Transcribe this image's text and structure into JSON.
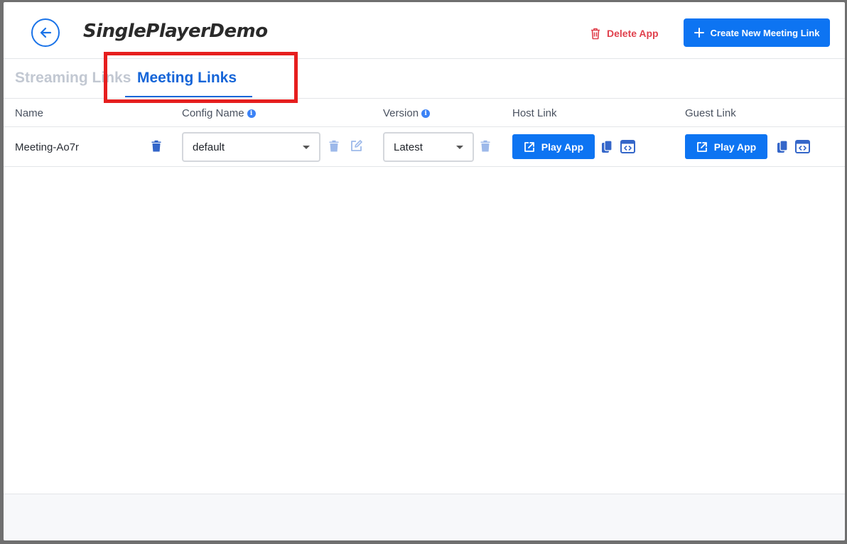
{
  "app": {
    "title": "SinglePlayerDemo",
    "delete_label": "Delete App",
    "create_label": "Create New Meeting Link"
  },
  "tabs": [
    {
      "label": "Streaming Links",
      "active": false
    },
    {
      "label": "Meeting Links",
      "active": true
    }
  ],
  "table": {
    "columns": [
      "Name",
      "Config Name",
      "Version",
      "Host Link",
      "Guest Link"
    ],
    "rows": [
      {
        "name": "Meeting-Ao7r",
        "config": "default",
        "version": "Latest",
        "host_button": "Play App",
        "guest_button": "Play App"
      }
    ]
  },
  "colors": {
    "primary": "#0d74f2",
    "danger": "#e0414d",
    "active_tab": "#1565d8",
    "inactive_tab": "#c2c8d2",
    "highlight": "#e61e1e"
  },
  "icons": {
    "back": "arrow-left-circle-icon",
    "delete_app": "trash-outline-icon",
    "create": "plus-icon",
    "row_delete": "trash-icon",
    "config_delete": "trash-icon",
    "config_edit": "edit-icon",
    "version_delete": "trash-icon",
    "play": "open-external-icon",
    "copy": "copy-icon",
    "embed": "embed-code-icon",
    "info": "info-icon"
  }
}
